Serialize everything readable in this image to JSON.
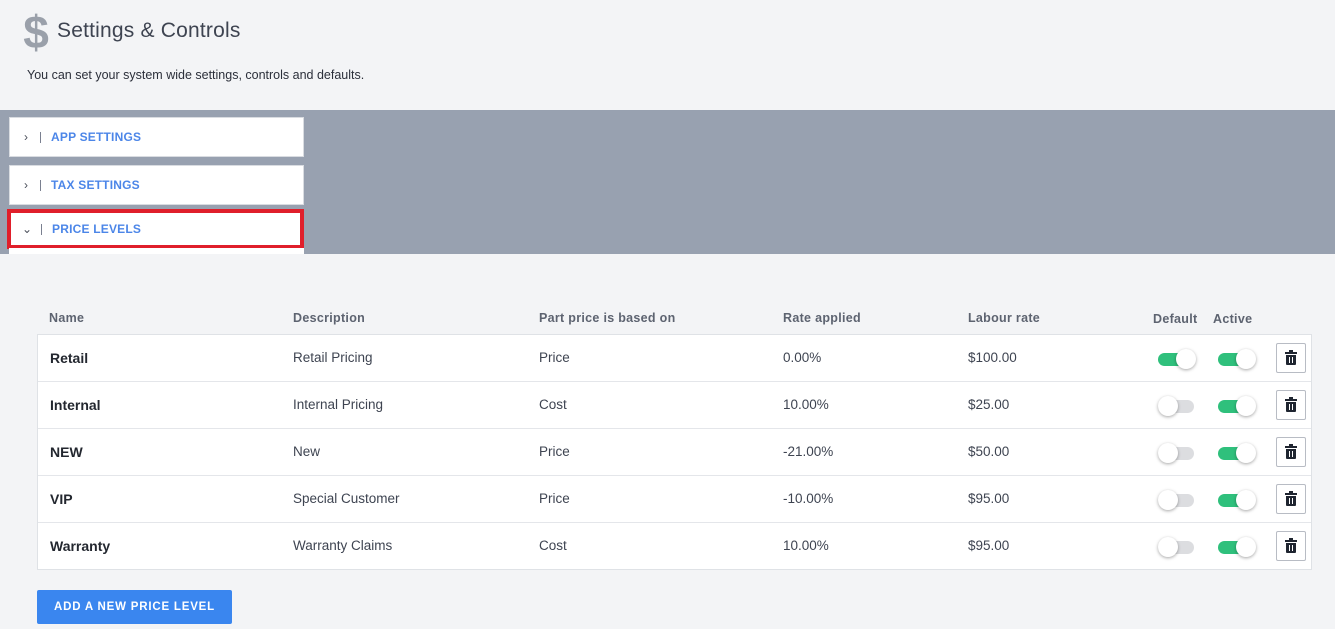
{
  "header": {
    "icon": "dollar-icon",
    "icon_glyph": "$",
    "title": "Settings & Controls",
    "subtitle": "You can set your system wide settings, controls and defaults."
  },
  "accordion": {
    "items": [
      {
        "label": "APP SETTINGS",
        "expanded": false,
        "chevron": "›"
      },
      {
        "label": "TAX SETTINGS",
        "expanded": false,
        "chevron": "›"
      },
      {
        "label": "PRICE LEVELS",
        "expanded": true,
        "chevron": "⌄"
      }
    ]
  },
  "table": {
    "columns": {
      "name": "Name",
      "description": "Description",
      "part_price": "Part price is based on",
      "rate": "Rate applied",
      "labour": "Labour rate",
      "default": "Default",
      "active": "Active"
    },
    "rows": [
      {
        "name": "Retail",
        "description": "Retail Pricing",
        "part_price": "Price",
        "rate": "0.00%",
        "labour": "$100.00",
        "default": true,
        "active": true
      },
      {
        "name": "Internal",
        "description": "Internal Pricing",
        "part_price": "Cost",
        "rate": "10.00%",
        "labour": "$25.00",
        "default": false,
        "active": true
      },
      {
        "name": "NEW",
        "description": "New",
        "part_price": "Price",
        "rate": "-21.00%",
        "labour": "$50.00",
        "default": false,
        "active": true
      },
      {
        "name": "VIP",
        "description": "Special Customer",
        "part_price": "Price",
        "rate": "-10.00%",
        "labour": "$95.00",
        "default": false,
        "active": true
      },
      {
        "name": "Warranty",
        "description": "Warranty Claims",
        "part_price": "Cost",
        "rate": "10.00%",
        "labour": "$95.00",
        "default": false,
        "active": true
      }
    ]
  },
  "actions": {
    "add_label": "ADD A NEW PRICE LEVEL"
  },
  "colors": {
    "accent": "#3a86ef",
    "toggle_on": "#2fc07c",
    "highlight": "#e01f2b",
    "band": "#98a1b0"
  }
}
